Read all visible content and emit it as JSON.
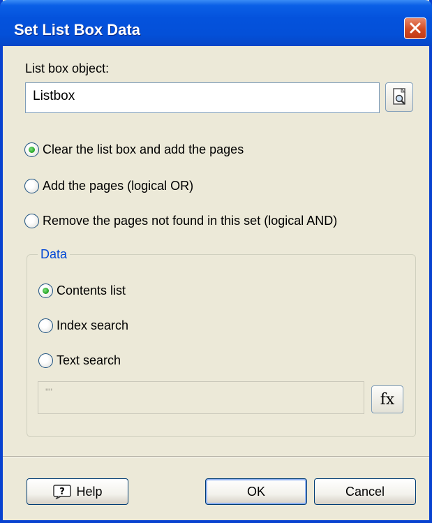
{
  "window": {
    "title": "Set List Box Data"
  },
  "listbox": {
    "label": "List box object:",
    "value": "Listbox"
  },
  "mode_options": [
    {
      "label": "Clear the list box and add the pages",
      "checked": true
    },
    {
      "label": "Add the pages (logical OR)",
      "checked": false
    },
    {
      "label": "Remove the pages not found in this set (logical AND)",
      "checked": false
    }
  ],
  "data_group": {
    "title": "Data",
    "options": [
      {
        "label": "Contents list",
        "checked": true
      },
      {
        "label": "Index search",
        "checked": false
      },
      {
        "label": "Text search",
        "checked": false
      }
    ],
    "expression_value": "\"\"",
    "fx_label": "fx"
  },
  "buttons": {
    "help": "Help",
    "ok": "OK",
    "cancel": "Cancel"
  },
  "icons": {
    "close": "close-icon",
    "browse": "browse-object-icon",
    "help": "help-icon",
    "fx": "function-icon"
  },
  "colors": {
    "titlebar": "#0452dc",
    "frame": "#0842d0",
    "dialog_bg": "#ece9d8",
    "group_title": "#0046d5",
    "close_button": "#d24a22"
  }
}
